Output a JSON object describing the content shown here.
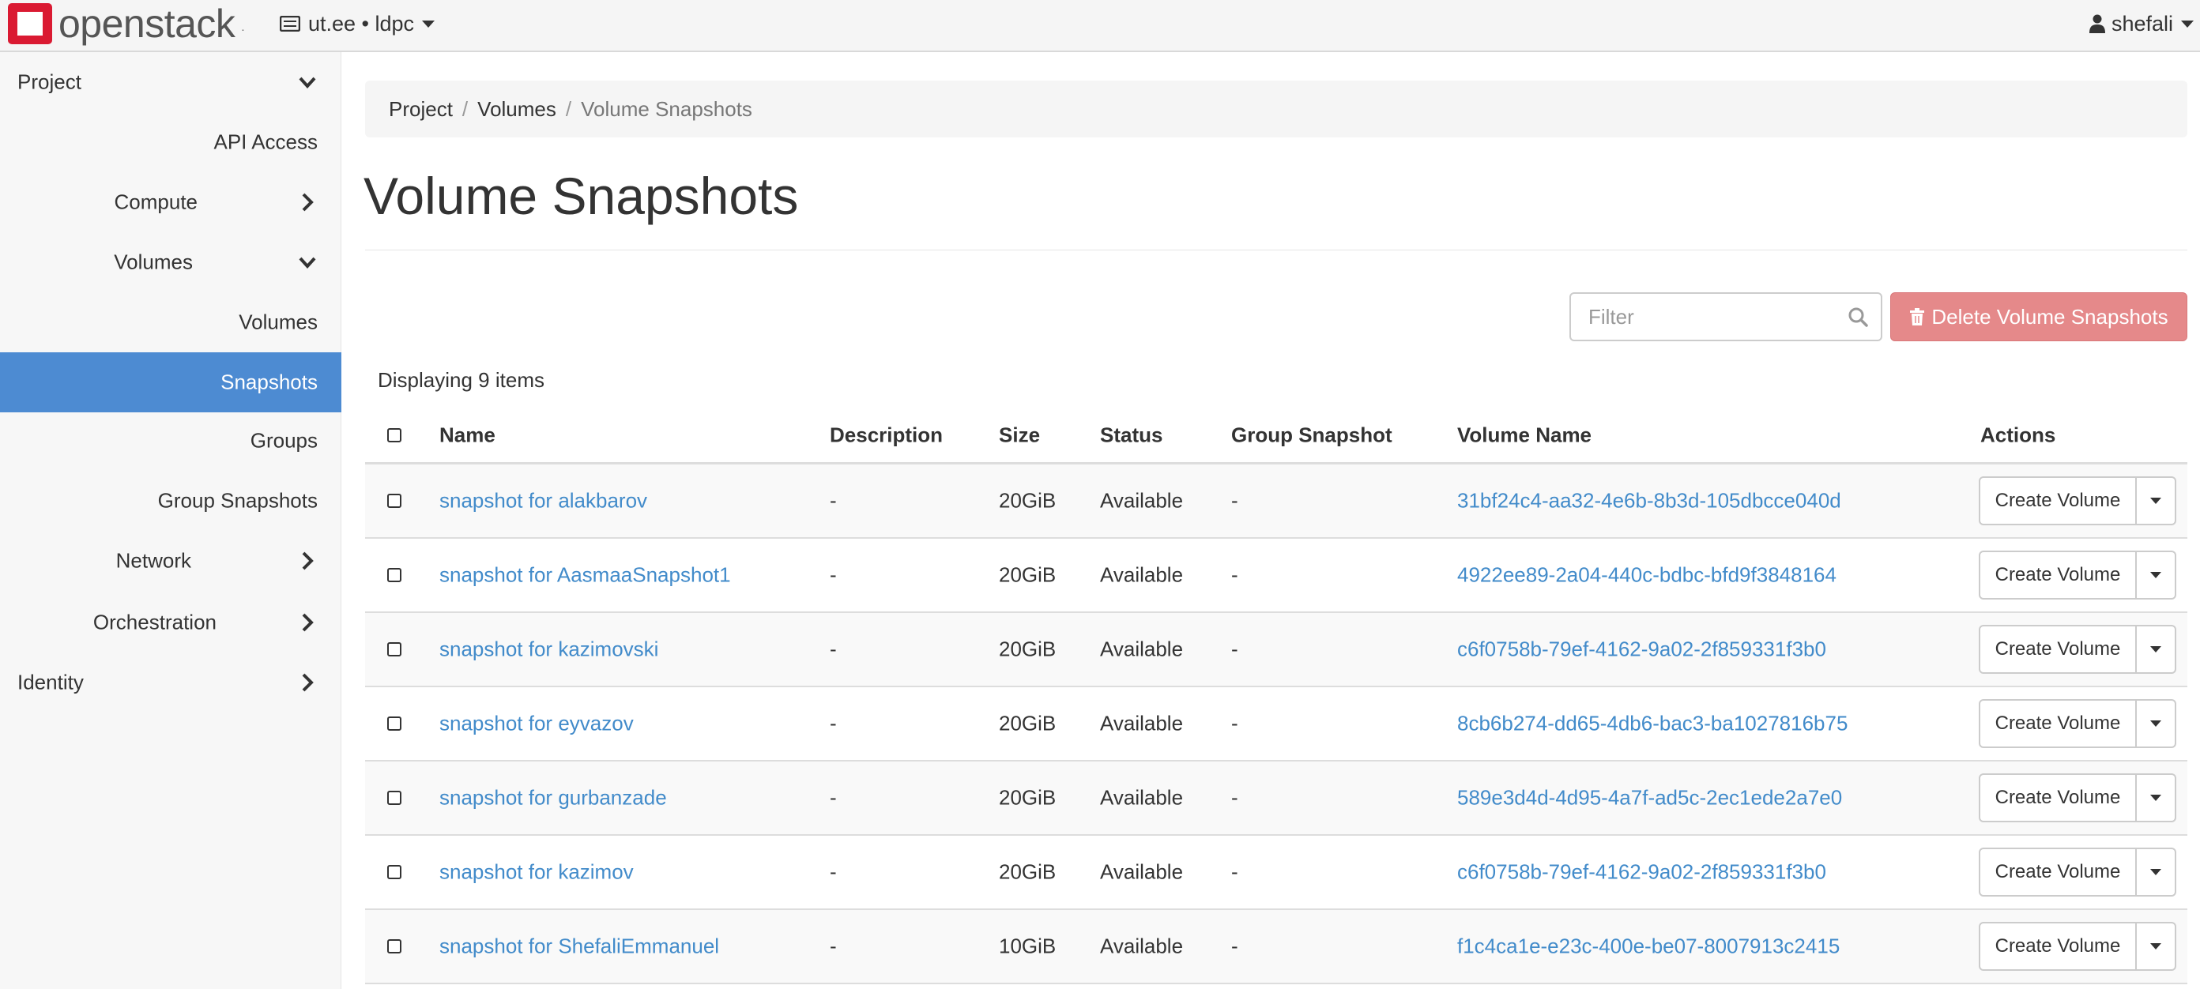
{
  "app": {
    "logo_text": "openstack",
    "logo_mark": "openstack-logo",
    "project_label": "ut.ee • ldpc",
    "user_label": "shefali"
  },
  "sidebar": {
    "items": [
      {
        "label": "Project",
        "chevron": "chevron-down"
      },
      {
        "label": "API Access"
      },
      {
        "label": "Compute",
        "chevron": "chevron-right"
      },
      {
        "label": "Volumes",
        "chevron": "chevron-down"
      },
      {
        "label": "Volumes"
      },
      {
        "label": "Snapshots",
        "active": true
      },
      {
        "label": "Groups"
      },
      {
        "label": "Group Snapshots"
      },
      {
        "label": "Network",
        "chevron": "chevron-right"
      },
      {
        "label": "Orchestration",
        "chevron": "chevron-right"
      },
      {
        "label": "Identity",
        "chevron": "chevron-right"
      }
    ]
  },
  "breadcrumb": {
    "items": [
      "Project",
      "Volumes",
      "Volume Snapshots"
    ],
    "separator": "/"
  },
  "page": {
    "title": "Volume Snapshots",
    "count_label": "Displaying 9 items"
  },
  "toolbar": {
    "filter_placeholder": "Filter",
    "delete_label": "Delete Volume Snapshots"
  },
  "table": {
    "headers": [
      "Name",
      "Description",
      "Size",
      "Status",
      "Group Snapshot",
      "Volume Name",
      "Actions"
    ],
    "rows": [
      {
        "name": "snapshot for alakbarov",
        "description": "-",
        "size": "20GiB",
        "status": "Available",
        "group_snapshot": "-",
        "volume_name": "31bf24c4-aa32-4e6b-8b3d-105dbcce040d",
        "action": "Create Volume"
      },
      {
        "name": "snapshot for AasmaaSnapshot1",
        "description": "-",
        "size": "20GiB",
        "status": "Available",
        "group_snapshot": "-",
        "volume_name": "4922ee89-2a04-440c-bdbc-bfd9f3848164",
        "action": "Create Volume"
      },
      {
        "name": "snapshot for kazimovski",
        "description": "-",
        "size": "20GiB",
        "status": "Available",
        "group_snapshot": "-",
        "volume_name": "c6f0758b-79ef-4162-9a02-2f859331f3b0",
        "action": "Create Volume"
      },
      {
        "name": "snapshot for eyvazov",
        "description": "-",
        "size": "20GiB",
        "status": "Available",
        "group_snapshot": "-",
        "volume_name": "8cb6b274-dd65-4db6-bac3-ba1027816b75",
        "action": "Create Volume"
      },
      {
        "name": "snapshot for gurbanzade",
        "description": "-",
        "size": "20GiB",
        "status": "Available",
        "group_snapshot": "-",
        "volume_name": "589e3d4d-4d95-4a7f-ad5c-2ec1ede2a7e0",
        "action": "Create Volume"
      },
      {
        "name": "snapshot for kazimov",
        "description": "-",
        "size": "20GiB",
        "status": "Available",
        "group_snapshot": "-",
        "volume_name": "c6f0758b-79ef-4162-9a02-2f859331f3b0",
        "action": "Create Volume"
      },
      {
        "name": "snapshot for ShefaliEmmanuel",
        "description": "-",
        "size": "10GiB",
        "status": "Available",
        "group_snapshot": "-",
        "volume_name": "f1c4ca1e-e23c-400e-be07-8007913c2415",
        "action": "Create Volume"
      }
    ]
  },
  "colors": {
    "accent": "#4d8bd2",
    "link": "#428bca",
    "danger": "#e5898a",
    "logo_red": "#da1a32"
  }
}
